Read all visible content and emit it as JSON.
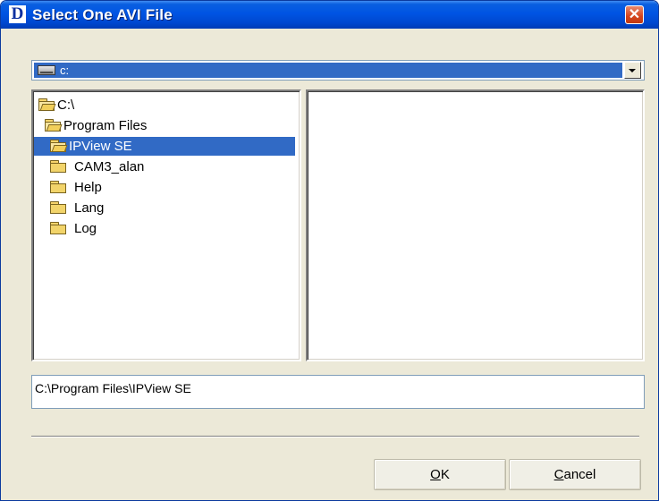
{
  "window": {
    "title": "Select One AVI File",
    "logo_letter": "D",
    "close_glyph": "✕"
  },
  "drive_combo": {
    "selected": "c:",
    "icon": "drive-icon"
  },
  "tree": {
    "items": [
      {
        "label": "C:\\",
        "icon": "open-folder-icon",
        "state": "open"
      },
      {
        "label": "Program Files",
        "icon": "open-folder-icon",
        "state": "open"
      },
      {
        "label": "IPView SE",
        "icon": "open-folder-icon",
        "state": "open-selected"
      },
      {
        "label": "CAM3_alan",
        "icon": "folder-icon",
        "state": "closed"
      },
      {
        "label": "Help",
        "icon": "folder-icon",
        "state": "closed"
      },
      {
        "label": "Lang",
        "icon": "folder-icon",
        "state": "closed"
      },
      {
        "label": "Log",
        "icon": "folder-icon",
        "state": "closed"
      }
    ]
  },
  "files": [],
  "path_field": {
    "value": "C:\\Program Files\\IPView SE"
  },
  "buttons": {
    "ok": {
      "mnemonic": "O",
      "rest": "K"
    },
    "cancel": {
      "mnemonic": "C",
      "rest": "ancel"
    }
  },
  "colors": {
    "titlebar": "#0054e3",
    "selection": "#316ac5",
    "dialog_bg": "#ece9d8",
    "close_button": "#d4421b"
  }
}
